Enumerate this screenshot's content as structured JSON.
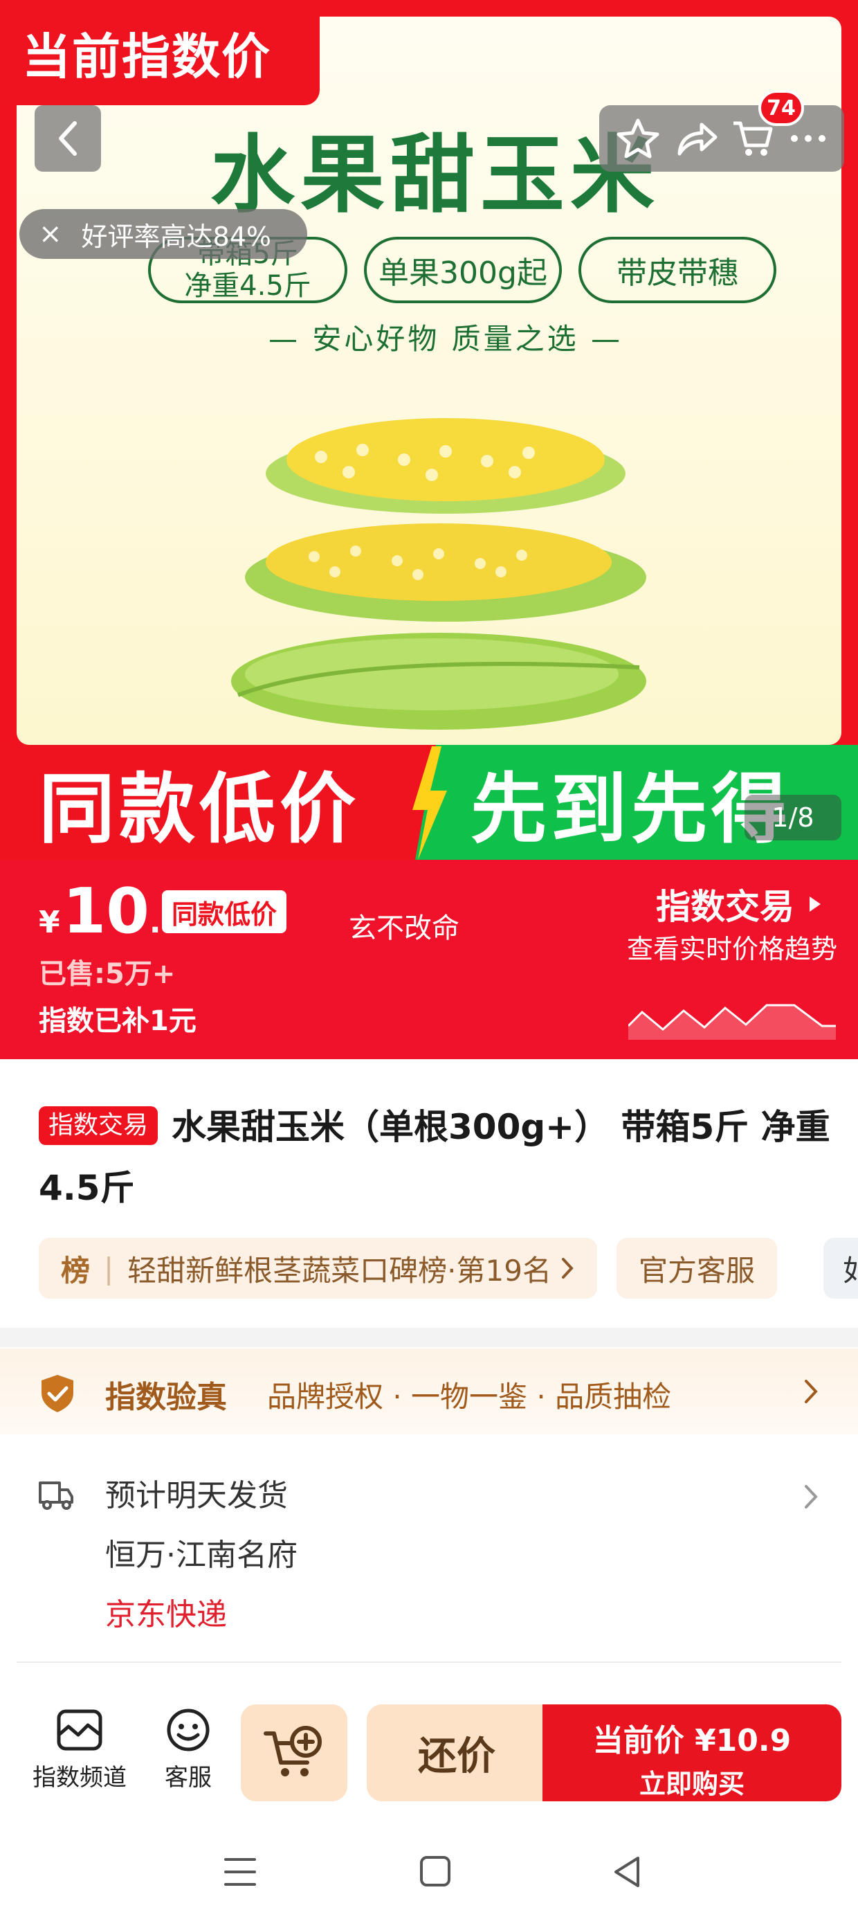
{
  "hero": {
    "corner_label": "当前指数价",
    "product_title": "水果甜玉米",
    "pills": [
      {
        "line1": "带箱5斤",
        "line2": "净重4.5斤"
      },
      {
        "line1": "单果300g起"
      },
      {
        "line1": "带皮带穗"
      }
    ],
    "slogan": "— 安心好物   质量之选 —",
    "banner_left": "同款低价",
    "banner_right": "先到先得",
    "image_counter": "1/8",
    "cart_count": "74",
    "toast_close": "×",
    "toast_text": "好评率高达84%"
  },
  "price_bar": {
    "currency": "¥",
    "price_int": "10",
    "price_dec": ".9",
    "same_price_badge": "同款低价",
    "sold": "已售:5万+",
    "subsidy": "指数已补1元",
    "motto": "玄不改命",
    "index_trade": "指数交易",
    "index_sub": "查看实时价格趋势"
  },
  "product": {
    "tag": "指数交易",
    "title": "水果甜玉米（单根300g+） 带箱5斤 净重4.5斤",
    "rank_icon": "榜",
    "rank_text": "轻甜新鲜根茎蔬菜口碑榜·第19名",
    "service_chip": "官方客服",
    "partial_chip": "如"
  },
  "auth": {
    "title": "指数验真",
    "desc": "品牌授权 · 一物一鉴 · 品质抽检"
  },
  "shipping": {
    "eta": "预计明天发货",
    "address": "恒万·江南名府",
    "courier": "京东快递"
  },
  "actions": {
    "channel": "指数频道",
    "service": "客服",
    "bargain": "还价",
    "buy_line1": "当前价 ¥10.9",
    "buy_line2": "立即购买"
  },
  "colors": {
    "brand_red": "#ef1320",
    "green": "#0fc14a",
    "gold": "#a05a1c"
  }
}
